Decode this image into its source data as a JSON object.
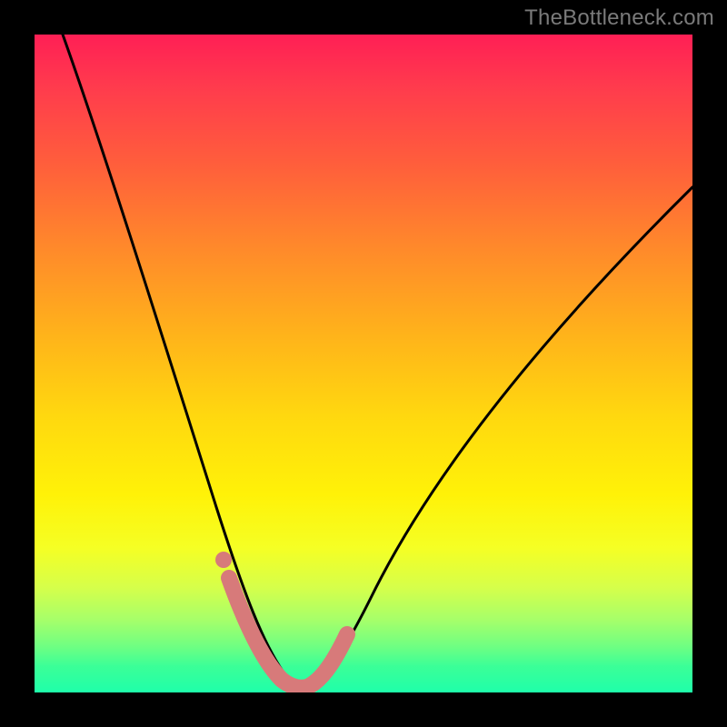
{
  "watermark": "TheBottleneck.com",
  "colors": {
    "frame": "#000000",
    "curve": "#000000",
    "overlay_marker": "#d77a7a",
    "gradient_stops": [
      "#ff1f55",
      "#ff3b4d",
      "#ff5f3b",
      "#ff8b2a",
      "#ffb41a",
      "#ffd80f",
      "#fff208",
      "#f5ff24",
      "#d6ff4a",
      "#a6ff6a",
      "#6fff82",
      "#3bff97",
      "#1fffaa"
    ]
  },
  "chart_data": {
    "type": "line",
    "title": "",
    "xlabel": "",
    "ylabel": "",
    "xlim": [
      0,
      1
    ],
    "ylim": [
      0,
      1
    ],
    "note": "No axis ticks or numeric labels are visible; values below are normalized fractions of the plot area (0 at left/bottom, 1 at right/top), read off the rendered curve geometry.",
    "series": [
      {
        "name": "black-curve",
        "stroke": "#000000",
        "x": [
          0.043,
          0.06,
          0.09,
          0.12,
          0.15,
          0.18,
          0.21,
          0.24,
          0.27,
          0.29,
          0.31,
          0.33,
          0.35,
          0.37,
          0.39,
          0.41,
          0.43,
          0.46,
          0.5,
          0.54,
          0.58,
          0.62,
          0.68,
          0.74,
          0.8,
          0.86,
          0.92,
          1.0
        ],
        "y": [
          1.0,
          0.93,
          0.82,
          0.715,
          0.61,
          0.51,
          0.41,
          0.32,
          0.235,
          0.18,
          0.135,
          0.095,
          0.06,
          0.035,
          0.018,
          0.008,
          0.015,
          0.04,
          0.095,
          0.165,
          0.24,
          0.32,
          0.42,
          0.5,
          0.565,
          0.63,
          0.69,
          0.77
        ]
      },
      {
        "name": "pink-overlay-segment",
        "stroke": "#d77a7a",
        "x": [
          0.29,
          0.31,
          0.33,
          0.35,
          0.37,
          0.39,
          0.41,
          0.43,
          0.46
        ],
        "y": [
          0.18,
          0.135,
          0.095,
          0.06,
          0.035,
          0.018,
          0.008,
          0.015,
          0.04
        ]
      }
    ],
    "markers": [
      {
        "name": "pink-dot",
        "x": 0.285,
        "y": 0.195,
        "color": "#d77a7a"
      }
    ]
  }
}
